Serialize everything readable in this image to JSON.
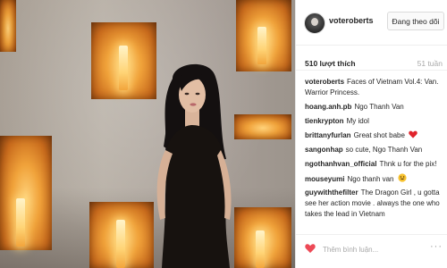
{
  "post": {
    "username": "voteroberts",
    "follow_label": "Đang theo dõi",
    "likes": "510 lượt thích",
    "time_ago": "51 tuần"
  },
  "comments": [
    {
      "user": "voteroberts",
      "text": "Faces of Vietnam Vol.4: Van. Warrior Princess.",
      "icon": null
    },
    {
      "user": "hoang.anh.pb",
      "text": "Ngo Thanh Van",
      "icon": null
    },
    {
      "user": "tienkrypton",
      "text": "My idol",
      "icon": null
    },
    {
      "user": "brittanyfurlan",
      "text": "Great shot babe",
      "icon": "red-heart-emoji"
    },
    {
      "user": "sangonhap",
      "text": "so cute, Ngo Thanh Van",
      "icon": null
    },
    {
      "user": "ngothanhvan_official",
      "text": "Thnk u for the pix!",
      "icon": null
    },
    {
      "user": "mouseyumi",
      "text": "Ngo thanh van",
      "icon": "grinning-emoji"
    },
    {
      "user": "guywiththefilter",
      "text": "The Dragon Girl , u gotta see her action movie . always the one who takes the lead in Vietnam",
      "icon": null
    }
  ],
  "footer": {
    "comment_placeholder": "Thêm bình luận...",
    "more_label": "···"
  },
  "colors": {
    "username": "#262626",
    "muted": "#a8a8a8",
    "like_heart": "#ed4956"
  }
}
